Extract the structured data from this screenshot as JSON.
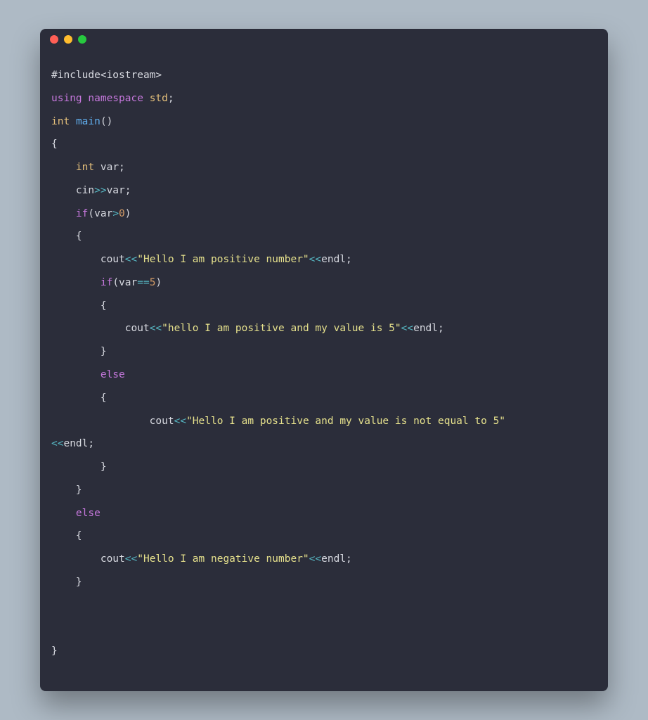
{
  "colors": {
    "background": "#aebac5",
    "window": "#2b2d3a",
    "dot_red": "#ff5f56",
    "dot_yellow": "#ffbd2e",
    "dot_green": "#27c93f",
    "text_default": "#d7d9e0",
    "text_keyword": "#c678dd",
    "text_type": "#e5c07b",
    "text_func": "#61afef",
    "text_string": "#e5e08c",
    "text_number": "#d19a66",
    "text_op": "#56b6c2"
  },
  "code": [
    [
      [
        "default",
        "#include<iostream>"
      ]
    ],
    [
      [
        "keyword",
        "using"
      ],
      [
        "default",
        " "
      ],
      [
        "keyword",
        "namespace"
      ],
      [
        "default",
        " "
      ],
      [
        "type",
        "std"
      ],
      [
        "default",
        ";"
      ]
    ],
    [
      [
        "type",
        "int"
      ],
      [
        "default",
        " "
      ],
      [
        "func",
        "main"
      ],
      [
        "default",
        "()"
      ]
    ],
    [
      [
        "default",
        "{"
      ]
    ],
    [
      [
        "default",
        "    "
      ],
      [
        "type",
        "int"
      ],
      [
        "default",
        " var;"
      ]
    ],
    [
      [
        "default",
        "    cin"
      ],
      [
        "op",
        ">>"
      ],
      [
        "default",
        "var;"
      ]
    ],
    [
      [
        "default",
        "    "
      ],
      [
        "keyword",
        "if"
      ],
      [
        "default",
        "(var"
      ],
      [
        "op",
        ">"
      ],
      [
        "number",
        "0"
      ],
      [
        "default",
        ")"
      ]
    ],
    [
      [
        "default",
        "    {"
      ]
    ],
    [
      [
        "default",
        "        cout"
      ],
      [
        "op",
        "<<"
      ],
      [
        "string",
        "\"Hello I am positive number\""
      ],
      [
        "op",
        "<<"
      ],
      [
        "default",
        "endl;"
      ]
    ],
    [
      [
        "default",
        "        "
      ],
      [
        "keyword",
        "if"
      ],
      [
        "default",
        "(var"
      ],
      [
        "op",
        "=="
      ],
      [
        "number",
        "5"
      ],
      [
        "default",
        ")"
      ]
    ],
    [
      [
        "default",
        "        {"
      ]
    ],
    [
      [
        "default",
        "            cout"
      ],
      [
        "op",
        "<<"
      ],
      [
        "string",
        "\"hello I am positive and my value is 5\""
      ],
      [
        "op",
        "<<"
      ],
      [
        "default",
        "endl;"
      ]
    ],
    [
      [
        "default",
        "        }"
      ]
    ],
    [
      [
        "default",
        "        "
      ],
      [
        "keyword",
        "else"
      ]
    ],
    [
      [
        "default",
        "        {"
      ]
    ],
    [
      [
        "default",
        "                cout"
      ],
      [
        "op",
        "<<"
      ],
      [
        "string",
        "\"Hello I am positive and my value is not equal to 5\""
      ]
    ],
    [
      [
        "op",
        "<<"
      ],
      [
        "default",
        "endl;"
      ]
    ],
    [
      [
        "default",
        "        }"
      ]
    ],
    [
      [
        "default",
        "    }"
      ]
    ],
    [
      [
        "default",
        "    "
      ],
      [
        "keyword",
        "else"
      ]
    ],
    [
      [
        "default",
        "    {"
      ]
    ],
    [
      [
        "default",
        "        cout"
      ],
      [
        "op",
        "<<"
      ],
      [
        "string",
        "\"Hello I am negative number\""
      ],
      [
        "op",
        "<<"
      ],
      [
        "default",
        "endl;"
      ]
    ],
    [
      [
        "default",
        "    }"
      ]
    ],
    [
      [
        "default",
        ""
      ]
    ],
    [
      [
        "default",
        ""
      ]
    ],
    [
      [
        "default",
        "}"
      ]
    ]
  ]
}
